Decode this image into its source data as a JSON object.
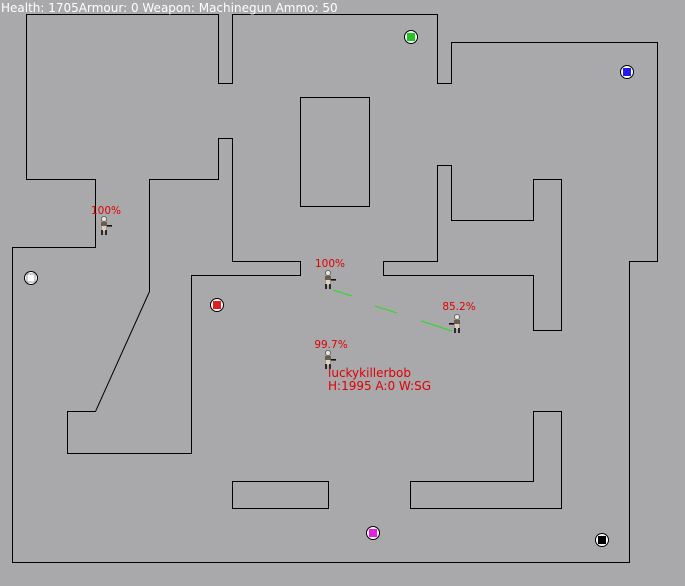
{
  "hud": {
    "text": "Health: 1705Armour: 0 Weapon: Machinegun Ammo: 50"
  },
  "colors": {
    "background": "#a9a8ab",
    "wall": "#000000",
    "health_label": "#e00000",
    "tracer": "#1ee01e",
    "pickup_green": "#1ec81e",
    "pickup_blue": "#1e1ee6",
    "pickup_red": "#e01e1e",
    "pickup_white": "#ffffff",
    "pickup_magenta": "#e61ee6",
    "pickup_black": "#000000"
  },
  "players": [
    {
      "health_label": "100%"
    },
    {
      "health_label": "100%"
    },
    {
      "health_label": "85.2%"
    },
    {
      "health_label": "99.7%",
      "name": "luckykillerbob",
      "stats": "H:1995 A:0 W:SG"
    }
  ],
  "pickups": [
    {
      "icon": "green-pickup-icon"
    },
    {
      "icon": "blue-pickup-icon"
    },
    {
      "icon": "white-pickup-icon"
    },
    {
      "icon": "red-pickup-icon"
    },
    {
      "icon": "magenta-pickup-icon"
    },
    {
      "icon": "black-pickup-icon"
    }
  ]
}
